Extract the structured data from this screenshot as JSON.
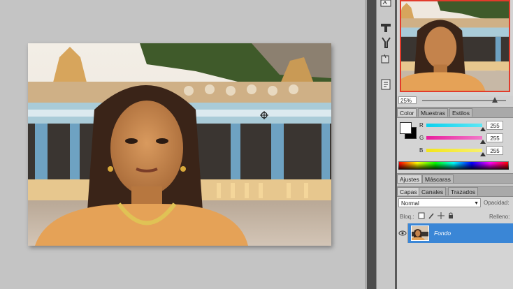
{
  "canvas": {
    "crosshair_icon": "crosshair-icon"
  },
  "navigator": {
    "zoom": "25%"
  },
  "color_panel": {
    "tabs": [
      {
        "label": "Color"
      },
      {
        "label": "Muestras"
      },
      {
        "label": "Estilos"
      }
    ],
    "channels": [
      {
        "label": "R",
        "value": "255",
        "color": "#19c8e6"
      },
      {
        "label": "G",
        "value": "255",
        "color": "#e61ea0"
      },
      {
        "label": "B",
        "value": "255",
        "color": "#f0e614"
      }
    ],
    "foreground": "#ffffff",
    "background": "#000000"
  },
  "adjust_panel": {
    "tabs": [
      {
        "label": "Ajustes"
      },
      {
        "label": "Máscaras"
      }
    ]
  },
  "layers_panel": {
    "tabs": [
      {
        "label": "Capas"
      },
      {
        "label": "Canales"
      },
      {
        "label": "Trazados"
      }
    ],
    "blend_mode": "Normal",
    "opacity_label": "Opacidad:",
    "lock_label": "Bloq.:",
    "fill_label": "Relleno:",
    "layer_name": "Fondo",
    "selected_color": "#3a86d6"
  },
  "toolbar_icons": [
    "brush-presets-icon",
    "clone-source-icon",
    "tool-presets-icon",
    "character-icon",
    "history-icon"
  ]
}
